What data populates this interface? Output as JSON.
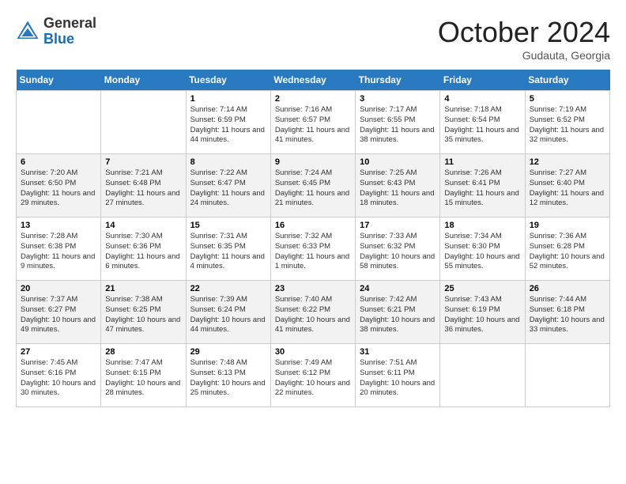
{
  "header": {
    "logo": {
      "general": "General",
      "blue": "Blue"
    },
    "title": "October 2024",
    "location": "Gudauta, Georgia"
  },
  "calendar": {
    "weekdays": [
      "Sunday",
      "Monday",
      "Tuesday",
      "Wednesday",
      "Thursday",
      "Friday",
      "Saturday"
    ],
    "weeks": [
      [
        {
          "day": "",
          "info": ""
        },
        {
          "day": "",
          "info": ""
        },
        {
          "day": "1",
          "info": "Sunrise: 7:14 AM\nSunset: 6:59 PM\nDaylight: 11 hours and 44 minutes."
        },
        {
          "day": "2",
          "info": "Sunrise: 7:16 AM\nSunset: 6:57 PM\nDaylight: 11 hours and 41 minutes."
        },
        {
          "day": "3",
          "info": "Sunrise: 7:17 AM\nSunset: 6:55 PM\nDaylight: 11 hours and 38 minutes."
        },
        {
          "day": "4",
          "info": "Sunrise: 7:18 AM\nSunset: 6:54 PM\nDaylight: 11 hours and 35 minutes."
        },
        {
          "day": "5",
          "info": "Sunrise: 7:19 AM\nSunset: 6:52 PM\nDaylight: 11 hours and 32 minutes."
        }
      ],
      [
        {
          "day": "6",
          "info": "Sunrise: 7:20 AM\nSunset: 6:50 PM\nDaylight: 11 hours and 29 minutes."
        },
        {
          "day": "7",
          "info": "Sunrise: 7:21 AM\nSunset: 6:48 PM\nDaylight: 11 hours and 27 minutes."
        },
        {
          "day": "8",
          "info": "Sunrise: 7:22 AM\nSunset: 6:47 PM\nDaylight: 11 hours and 24 minutes."
        },
        {
          "day": "9",
          "info": "Sunrise: 7:24 AM\nSunset: 6:45 PM\nDaylight: 11 hours and 21 minutes."
        },
        {
          "day": "10",
          "info": "Sunrise: 7:25 AM\nSunset: 6:43 PM\nDaylight: 11 hours and 18 minutes."
        },
        {
          "day": "11",
          "info": "Sunrise: 7:26 AM\nSunset: 6:41 PM\nDaylight: 11 hours and 15 minutes."
        },
        {
          "day": "12",
          "info": "Sunrise: 7:27 AM\nSunset: 6:40 PM\nDaylight: 11 hours and 12 minutes."
        }
      ],
      [
        {
          "day": "13",
          "info": "Sunrise: 7:28 AM\nSunset: 6:38 PM\nDaylight: 11 hours and 9 minutes."
        },
        {
          "day": "14",
          "info": "Sunrise: 7:30 AM\nSunset: 6:36 PM\nDaylight: 11 hours and 6 minutes."
        },
        {
          "day": "15",
          "info": "Sunrise: 7:31 AM\nSunset: 6:35 PM\nDaylight: 11 hours and 4 minutes."
        },
        {
          "day": "16",
          "info": "Sunrise: 7:32 AM\nSunset: 6:33 PM\nDaylight: 11 hours and 1 minute."
        },
        {
          "day": "17",
          "info": "Sunrise: 7:33 AM\nSunset: 6:32 PM\nDaylight: 10 hours and 58 minutes."
        },
        {
          "day": "18",
          "info": "Sunrise: 7:34 AM\nSunset: 6:30 PM\nDaylight: 10 hours and 55 minutes."
        },
        {
          "day": "19",
          "info": "Sunrise: 7:36 AM\nSunset: 6:28 PM\nDaylight: 10 hours and 52 minutes."
        }
      ],
      [
        {
          "day": "20",
          "info": "Sunrise: 7:37 AM\nSunset: 6:27 PM\nDaylight: 10 hours and 49 minutes."
        },
        {
          "day": "21",
          "info": "Sunrise: 7:38 AM\nSunset: 6:25 PM\nDaylight: 10 hours and 47 minutes."
        },
        {
          "day": "22",
          "info": "Sunrise: 7:39 AM\nSunset: 6:24 PM\nDaylight: 10 hours and 44 minutes."
        },
        {
          "day": "23",
          "info": "Sunrise: 7:40 AM\nSunset: 6:22 PM\nDaylight: 10 hours and 41 minutes."
        },
        {
          "day": "24",
          "info": "Sunrise: 7:42 AM\nSunset: 6:21 PM\nDaylight: 10 hours and 38 minutes."
        },
        {
          "day": "25",
          "info": "Sunrise: 7:43 AM\nSunset: 6:19 PM\nDaylight: 10 hours and 36 minutes."
        },
        {
          "day": "26",
          "info": "Sunrise: 7:44 AM\nSunset: 6:18 PM\nDaylight: 10 hours and 33 minutes."
        }
      ],
      [
        {
          "day": "27",
          "info": "Sunrise: 7:45 AM\nSunset: 6:16 PM\nDaylight: 10 hours and 30 minutes."
        },
        {
          "day": "28",
          "info": "Sunrise: 7:47 AM\nSunset: 6:15 PM\nDaylight: 10 hours and 28 minutes."
        },
        {
          "day": "29",
          "info": "Sunrise: 7:48 AM\nSunset: 6:13 PM\nDaylight: 10 hours and 25 minutes."
        },
        {
          "day": "30",
          "info": "Sunrise: 7:49 AM\nSunset: 6:12 PM\nDaylight: 10 hours and 22 minutes."
        },
        {
          "day": "31",
          "info": "Sunrise: 7:51 AM\nSunset: 6:11 PM\nDaylight: 10 hours and 20 minutes."
        },
        {
          "day": "",
          "info": ""
        },
        {
          "day": "",
          "info": ""
        }
      ]
    ]
  }
}
